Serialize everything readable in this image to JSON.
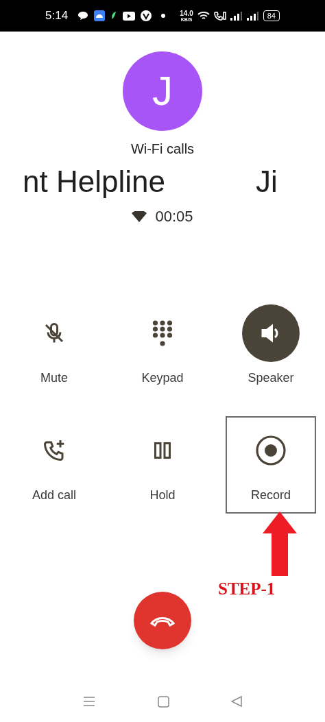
{
  "status_bar": {
    "time": "5:14",
    "speed_value": "14.0",
    "speed_unit": "KB/S",
    "battery": "84"
  },
  "caller": {
    "avatar_letter": "J",
    "call_type": "Wi-Fi calls",
    "name_parts": [
      "nt Helpline",
      "Ji"
    ],
    "timer": "00:05"
  },
  "controls": [
    {
      "kind": "mute",
      "label": "Mute",
      "on": false,
      "highlighted": false
    },
    {
      "kind": "keypad",
      "label": "Keypad",
      "on": false,
      "highlighted": false
    },
    {
      "kind": "speaker",
      "label": "Speaker",
      "on": true,
      "highlighted": false
    },
    {
      "kind": "add_call",
      "label": "Add call",
      "on": false,
      "highlighted": false
    },
    {
      "kind": "hold",
      "label": "Hold",
      "on": false,
      "highlighted": false
    },
    {
      "kind": "record",
      "label": "Record",
      "on": false,
      "highlighted": true
    }
  ],
  "annotation": {
    "label": "STEP-1"
  }
}
